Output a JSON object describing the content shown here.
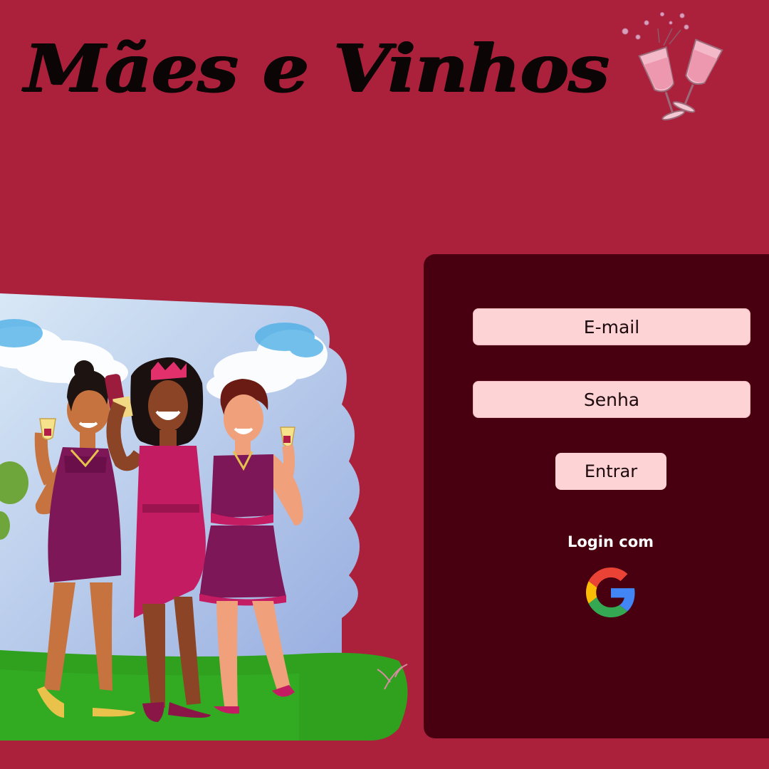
{
  "header": {
    "title": "Mães e Vinhos",
    "logo_icon": "wine-glasses-toast-icon"
  },
  "login": {
    "email_label": "E-mail",
    "password_label": "Senha",
    "submit_label": "Entrar",
    "social_label": "Login com",
    "social_icon": "google-icon"
  },
  "illustration": {
    "description_icon": "moms-with-wine-illustration"
  },
  "colors": {
    "background": "#ab213b",
    "panel": "#480010",
    "field": "#fdd3d6",
    "title": "#0b0506"
  }
}
